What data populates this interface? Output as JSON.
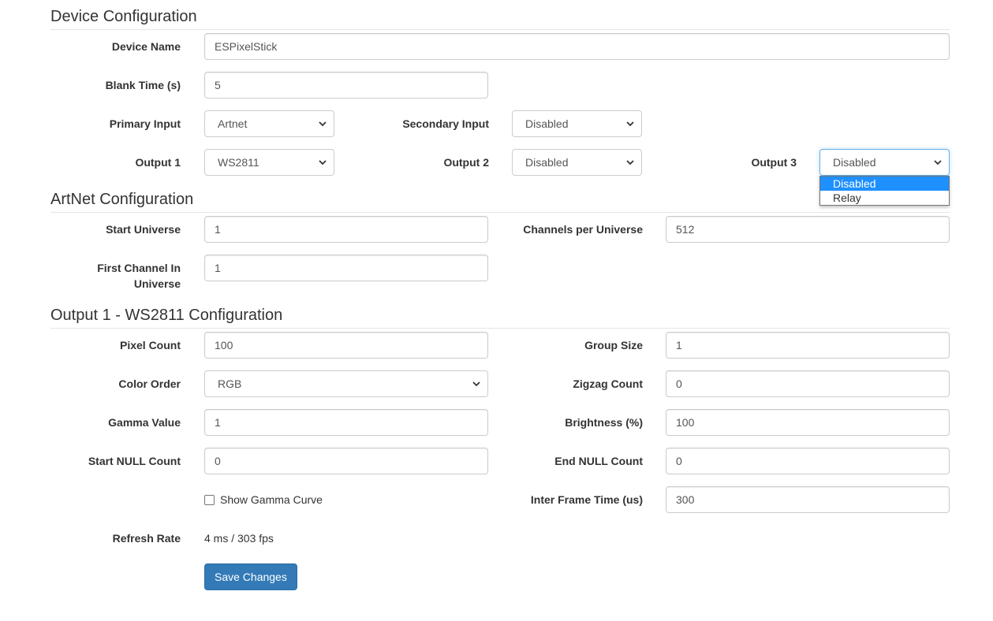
{
  "device": {
    "title": "Device Configuration",
    "device_name": {
      "label": "Device Name",
      "value": "ESPixelStick"
    },
    "blank_time": {
      "label": "Blank Time (s)",
      "value": "5"
    },
    "primary_input": {
      "label": "Primary Input",
      "value": "Artnet"
    },
    "secondary_input": {
      "label": "Secondary Input",
      "value": "Disabled"
    },
    "output1": {
      "label": "Output 1",
      "value": "WS2811"
    },
    "output2": {
      "label": "Output 2",
      "value": "Disabled"
    },
    "output3": {
      "label": "Output 3",
      "value": "Disabled",
      "options": [
        "Disabled",
        "Relay"
      ],
      "highlighted": "Disabled"
    }
  },
  "artnet": {
    "title": "ArtNet Configuration",
    "start_universe": {
      "label": "Start Universe",
      "value": "1"
    },
    "channels_per_universe": {
      "label": "Channels per Universe",
      "value": "512"
    },
    "first_channel_line1": "First Channel In",
    "first_channel_line2": "Universe",
    "first_channel_value": "1"
  },
  "output": {
    "title": "Output 1 - WS2811 Configuration",
    "pixel_count": {
      "label": "Pixel Count",
      "value": "100"
    },
    "group_size": {
      "label": "Group Size",
      "value": "1"
    },
    "color_order": {
      "label": "Color Order",
      "value": "RGB"
    },
    "zigzag_count": {
      "label": "Zigzag Count",
      "value": "0"
    },
    "gamma_value": {
      "label": "Gamma Value",
      "value": "1"
    },
    "brightness": {
      "label": "Brightness (%)",
      "value": "100"
    },
    "start_null": {
      "label": "Start NULL Count",
      "value": "0"
    },
    "end_null": {
      "label": "End NULL Count",
      "value": "0"
    },
    "show_gamma": {
      "label": "Show Gamma Curve",
      "checked": false
    },
    "inter_frame": {
      "label": "Inter Frame Time (us)",
      "value": "300"
    },
    "refresh_rate": {
      "label": "Refresh Rate",
      "value": "4 ms / 303 fps"
    }
  },
  "actions": {
    "save_label": "Save Changes"
  },
  "colors": {
    "primary": "#337ab7",
    "focus": "#66afe9",
    "highlight": "#1e90ff"
  }
}
